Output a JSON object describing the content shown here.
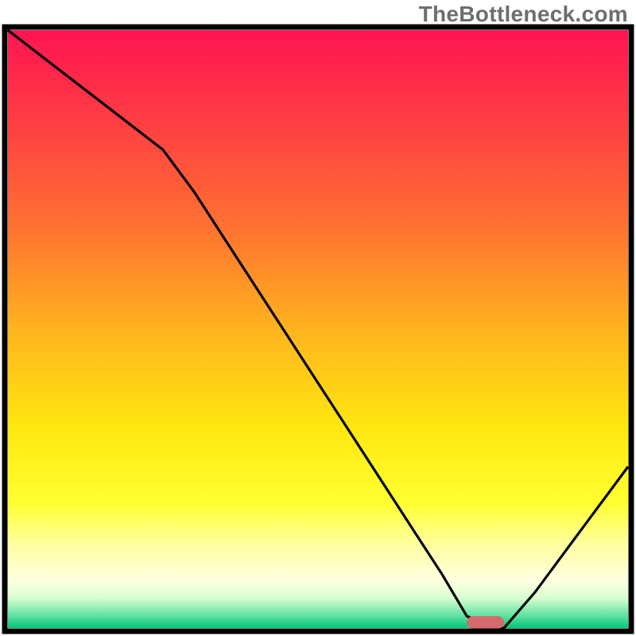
{
  "watermark": "TheBottleneck.com",
  "colors": {
    "border": "#000000",
    "curve": "#000000",
    "marker_fill": "#d56a6c",
    "gradient_stops": [
      {
        "offset": 0.0,
        "color": "#ff1452"
      },
      {
        "offset": 0.16,
        "color": "#ff3f42"
      },
      {
        "offset": 0.33,
        "color": "#ff7230"
      },
      {
        "offset": 0.5,
        "color": "#ffb31f"
      },
      {
        "offset": 0.66,
        "color": "#ffe60f"
      },
      {
        "offset": 0.79,
        "color": "#ffff30"
      },
      {
        "offset": 0.86,
        "color": "#ffffa0"
      },
      {
        "offset": 0.92,
        "color": "#ffffe0"
      },
      {
        "offset": 0.95,
        "color": "#d8ffd0"
      },
      {
        "offset": 0.98,
        "color": "#5de0a0"
      },
      {
        "offset": 1.0,
        "color": "#00c878"
      }
    ]
  },
  "chart_data": {
    "type": "line",
    "title": "",
    "xlabel": "",
    "ylabel": "",
    "xlim": [
      0,
      100
    ],
    "ylim": [
      0,
      100
    ],
    "x": [
      0,
      5,
      10,
      15,
      20,
      25,
      30,
      35,
      40,
      45,
      50,
      55,
      60,
      65,
      70,
      74,
      78,
      80,
      85,
      90,
      95,
      100
    ],
    "values": [
      100,
      96,
      92,
      88,
      84,
      80,
      73,
      65,
      57,
      49,
      41,
      33,
      25,
      17,
      9,
      2,
      0,
      0,
      6,
      13,
      20,
      27
    ],
    "minimum_marker": {
      "x_start": 74,
      "x_end": 80,
      "y": 0
    },
    "note": "x is horizontal position in % of plot width (left→right); values are vertical position in % of plot height (0 = bottom baseline, 100 = top). Curve descends from top-left to a minimum near x≈74–80 at the baseline, then rises toward the right edge."
  }
}
